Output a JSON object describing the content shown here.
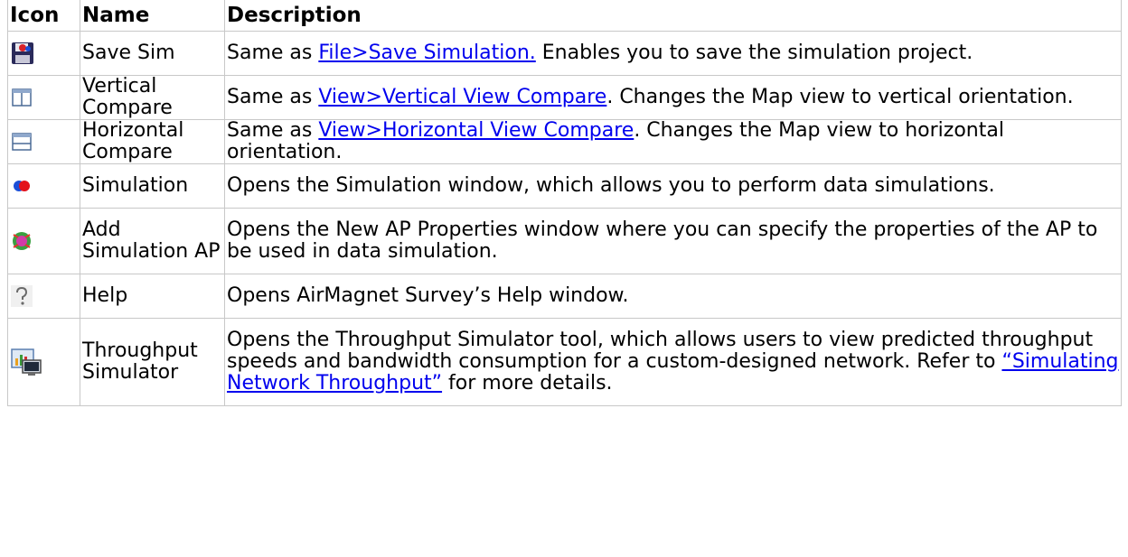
{
  "headers": {
    "icon": "Icon",
    "name": "Name",
    "description": "Description"
  },
  "rows": [
    {
      "icon": "save-floppy-icon",
      "name": "Save Sim",
      "desc_prefix": "Same as ",
      "link_text": "File>Save Simulation.",
      "desc_suffix": " Enables you to save the simulation project."
    },
    {
      "icon": "vertical-compare-icon",
      "name": "Vertical Compare",
      "desc_prefix": "Same as ",
      "link_text": "View>Vertical View Compare",
      "desc_suffix": ". Changes the Map view to vertical orientation."
    },
    {
      "icon": "horizontal-compare-icon",
      "name": "Horizontal Compare",
      "desc_prefix": "Same as ",
      "link_text": "View>Horizontal View Compare",
      "desc_suffix": ". Changes the Map view to horizontal orientation."
    },
    {
      "icon": "simulation-icon",
      "name": "Simulation",
      "desc_prefix": "Opens the Simulation window, which allows you to perform data simulations.",
      "link_text": "",
      "desc_suffix": ""
    },
    {
      "icon": "add-simulation-ap-icon",
      "name": "Add Simulation AP",
      "desc_prefix": "Opens the New AP Properties window where you can specify the properties of the AP to be used in data simulation.",
      "link_text": "",
      "desc_suffix": ""
    },
    {
      "icon": "help-question-icon",
      "name": "Help",
      "desc_prefix": "Opens AirMagnet Survey’s Help window.",
      "link_text": "",
      "desc_suffix": ""
    },
    {
      "icon": "throughput-simulator-icon",
      "name": "Throughput Simulator",
      "desc_prefix": "Opens the Throughput Simulator tool, which allows users to view predicted throughput speeds and bandwidth consumption for a custom-designed network. Refer to ",
      "link_text": "“Simulating Network Throughput”",
      "desc_suffix": " for more details."
    }
  ]
}
